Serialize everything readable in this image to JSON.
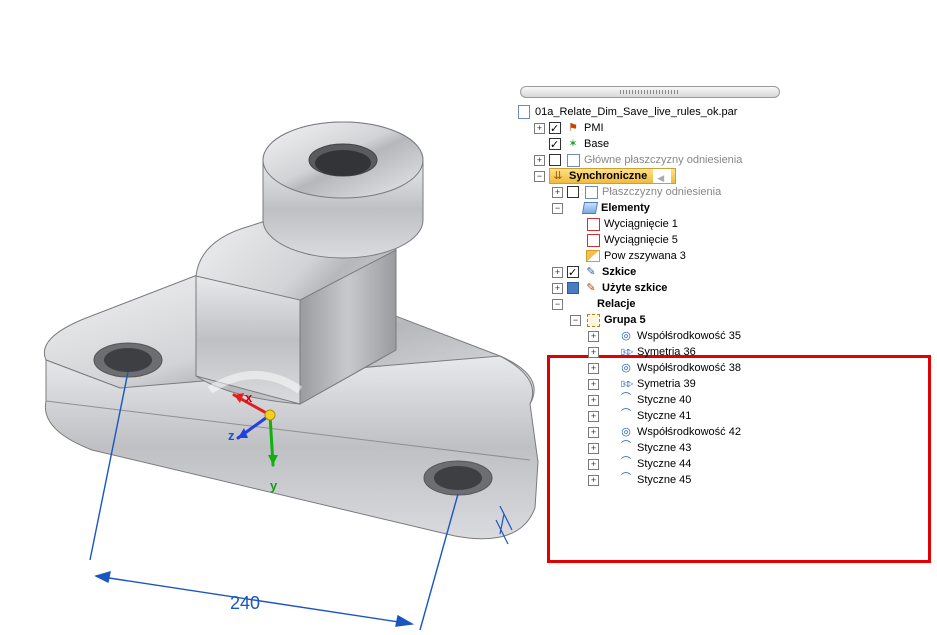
{
  "viewport": {
    "dimension_value": "240",
    "axes": {
      "x": "x",
      "y": "y",
      "z": "z"
    }
  },
  "tree": {
    "root": {
      "label": "01a_Relate_Dim_Save_live_rules_ok.par"
    },
    "pmi": {
      "label": "PMI"
    },
    "base": {
      "label": "Base"
    },
    "ref_planes": {
      "label": "Główne płaszczyzny odniesienia"
    },
    "sync": {
      "label": "Synchroniczne"
    },
    "sync_ref_planes": {
      "label": "Płaszczyzny odniesienia"
    },
    "elements": {
      "label": "Elementy"
    },
    "extrude1": {
      "label": "Wyciągnięcie 1"
    },
    "extrude5": {
      "label": "Wyciągnięcie 5"
    },
    "stitched3": {
      "label": "Pow zszywana 3"
    },
    "sketches": {
      "label": "Szkice"
    },
    "used_sketches": {
      "label": "Użyte szkice"
    },
    "relations": {
      "label": "Relacje"
    },
    "group5": {
      "label": "Grupa 5"
    },
    "items": [
      {
        "kind": "conc",
        "label": "Współśrodkowość 35"
      },
      {
        "kind": "sym",
        "label": "Symetria 36"
      },
      {
        "kind": "conc",
        "label": "Współśrodkowość 38"
      },
      {
        "kind": "sym",
        "label": "Symetria 39"
      },
      {
        "kind": "tan",
        "label": "Styczne 40"
      },
      {
        "kind": "tan",
        "label": "Styczne 41"
      },
      {
        "kind": "conc",
        "label": "Współśrodkowość 42"
      },
      {
        "kind": "tan",
        "label": "Styczne 43"
      },
      {
        "kind": "tan",
        "label": "Styczne 44"
      },
      {
        "kind": "tan",
        "label": "Styczne 45"
      }
    ]
  }
}
